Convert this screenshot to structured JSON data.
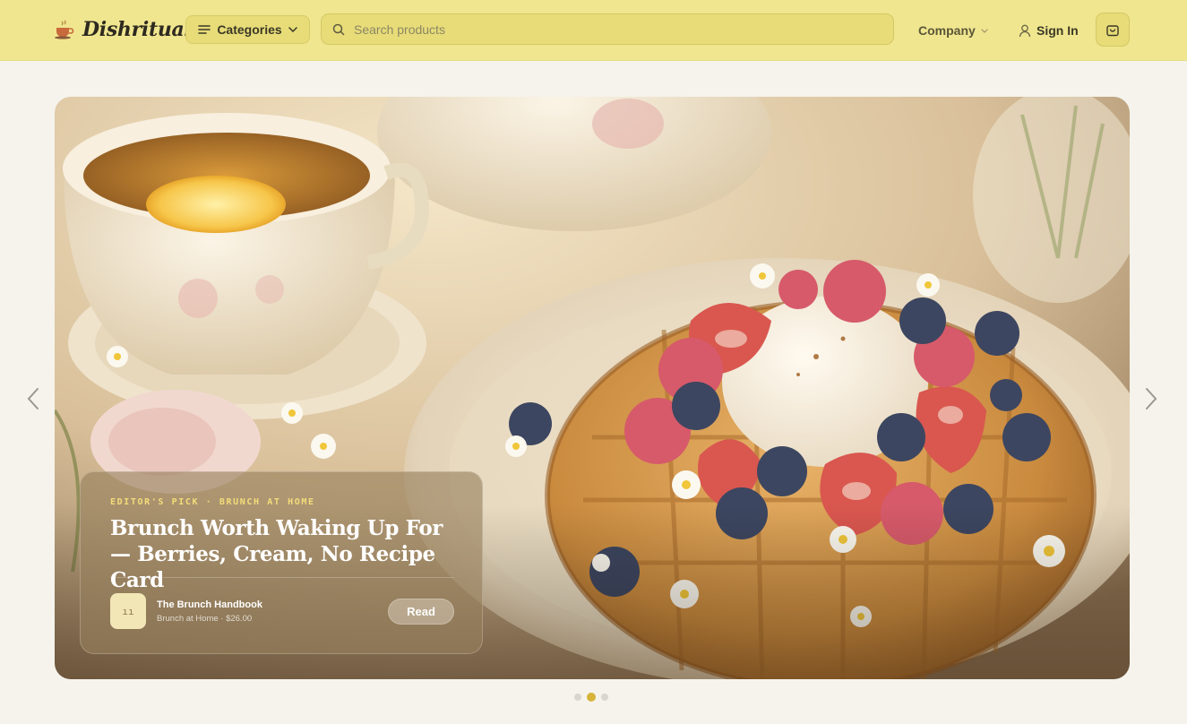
{
  "brand": {
    "name": "Dishritual",
    "logo_icon": "tea-cup-icon"
  },
  "header": {
    "categories_label": "Categories",
    "search_placeholder": "Search products",
    "company_label": "Company",
    "signin_label": "Sign In",
    "cart_icon": "shopping-bag-icon"
  },
  "hero": {
    "image_alt": "Waffle with berries and cream beside a cup of tea with lemon",
    "eyebrow": "EDITOR'S PICK · BRUNCH AT HOME",
    "headline": "Brunch Worth Waking Up For — Berries, Cream, No Recipe Card",
    "product": {
      "name": "The Brunch Handbook",
      "meta": "Brunch at Home · $26.00",
      "thumb_glyph": "ıı"
    },
    "cta_label": "Read"
  },
  "carousel": {
    "slides": 3,
    "active_index": 1
  },
  "colors": {
    "header_bg": "#f0e68f",
    "accent": "#d6b43a",
    "eyebrow": "#f3dc7a"
  }
}
